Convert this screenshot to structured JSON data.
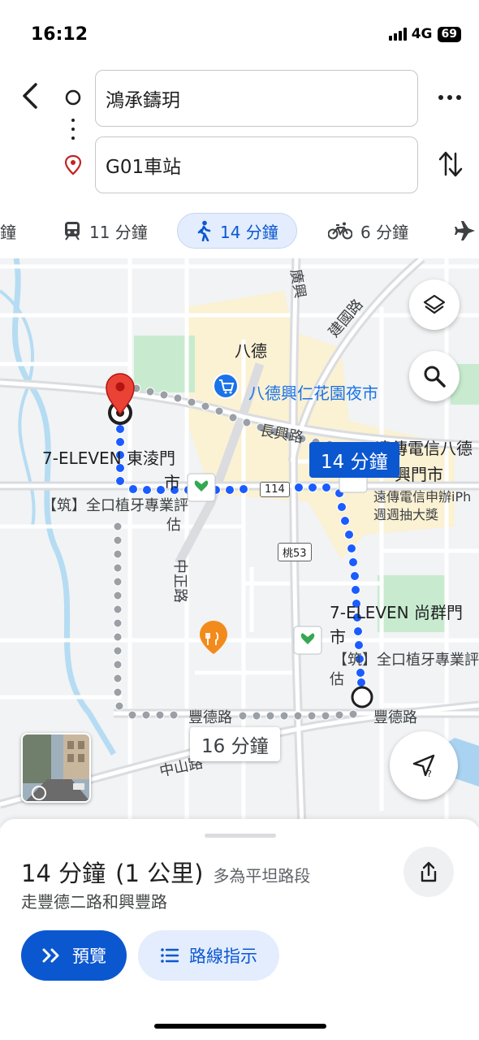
{
  "status_bar": {
    "time": "16:12",
    "network": "4G",
    "battery": "69"
  },
  "search": {
    "origin": "鴻承鑄玥",
    "destination": "G01車站"
  },
  "icons": {
    "back": "chevron-left-icon",
    "more": "more-horiz-icon",
    "swap": "swap-vert-icon",
    "layers": "layers-icon",
    "search": "search-icon",
    "location": "location-arrow-icon",
    "share": "share-icon"
  },
  "modes": {
    "partial": "鐘",
    "transit": "11 分鐘",
    "walk": "14 分鐘",
    "bike": "6 分鐘"
  },
  "map": {
    "labels": {
      "bade": "八德",
      "night_market": "八德興仁花園夜市",
      "changxing": "長興路",
      "jianguo": "建國路",
      "guangxing": "廣興",
      "zhongzheng": "中正路",
      "fengde_left": "豐德路",
      "fengde_right": "豐德路",
      "zhongshan": "中山路",
      "seven_dongling": "7-ELEVEN 東淩門",
      "seven_dongling_2": "市",
      "dental_left_1": "【筑】全口植牙專業評",
      "dental_left_2": "估",
      "fareast_1": "遠傳電信八德",
      "fareast_2": "興門市",
      "fareast_promo_1": "遠傳電信申辦iPh",
      "fareast_promo_2": "週週抽大獎",
      "seven_shangqun": "7-ELEVEN 尚群門",
      "seven_shangqun_2": "市",
      "dental_right_1": "【筑】全口植牙專業評",
      "dental_right_2": "估"
    },
    "road_badges": {
      "r114": "114",
      "tao53": "桃53"
    },
    "route_time": "14 分鐘",
    "alt_route_time": "16 分鐘",
    "colors": {
      "route": "#1a5cff",
      "alt_route": "#9aa0a6",
      "park": "#c8ebcf",
      "commercial": "#fbf1d3"
    }
  },
  "sheet": {
    "time": "14 分鐘",
    "distance": "(1 公里)",
    "terrain": "多為平坦路段",
    "via": "走豐德二路和興豐路",
    "preview_label": "預覽",
    "steps_label": "路線指示"
  }
}
